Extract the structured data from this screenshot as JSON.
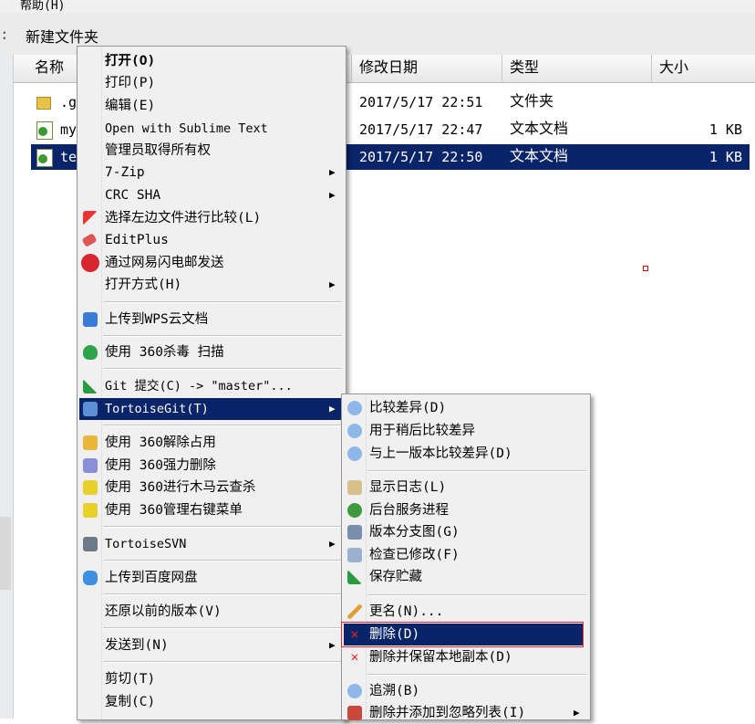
{
  "menubar": {
    "help": "帮助(H)"
  },
  "toolbar": {
    "sep": ":",
    "new_folder": "新建文件夹"
  },
  "columns": {
    "name": "名称",
    "modified": "修改日期",
    "type": "类型",
    "size": "大小"
  },
  "files": [
    {
      "name": ".g",
      "modified": "2017/5/17 22:51",
      "type": "文件夹",
      "size": "",
      "icon": "folder-icon"
    },
    {
      "name": "my",
      "modified": "2017/5/17 22:47",
      "type": "文本文档",
      "size": "1 KB",
      "icon": "text-file-icon"
    },
    {
      "name": "te",
      "modified": "2017/5/17 22:50",
      "type": "文本文档",
      "size": "1 KB",
      "icon": "text-file-icon",
      "selected": true
    }
  ],
  "context_menu": {
    "items": [
      {
        "label": "打开(O)",
        "bold": true
      },
      {
        "label": "打印(P)"
      },
      {
        "label": "编辑(E)"
      },
      {
        "label": "Open with Sublime Text"
      },
      {
        "label": "管理员取得所有权"
      },
      {
        "label": "7-Zip",
        "submenu": true
      },
      {
        "label": "CRC SHA",
        "submenu": true
      },
      {
        "label": "选择左边文件进行比较(L)",
        "icon": "compare-arrow-icon"
      },
      {
        "label": "EditPlus",
        "icon": "editplus-icon"
      },
      {
        "label": "通过网易闪电邮发送",
        "icon": "netease-mail-icon"
      },
      {
        "label": "打开方式(H)",
        "submenu": true
      },
      {
        "label": "上传到WPS云文档",
        "icon": "wps-cloud-icon"
      },
      {
        "label": "使用 360杀毒 扫描",
        "icon": "360-antivirus-icon"
      },
      {
        "label": "Git 提交(C) -> \"master\"...",
        "icon": "git-commit-icon"
      },
      {
        "label": "TortoiseGit(T)",
        "icon": "tortoisegit-icon",
        "submenu": true,
        "highlighted": true
      },
      {
        "label": "使用 360解除占用",
        "icon": "360-unlock-icon"
      },
      {
        "label": "使用 360强力删除",
        "icon": "360-shred-icon"
      },
      {
        "label": "使用 360进行木马云查杀",
        "icon": "360-trojan-icon"
      },
      {
        "label": "使用 360管理右键菜单",
        "icon": "360-menu-icon"
      },
      {
        "label": "TortoiseSVN",
        "icon": "tortoisesvn-icon",
        "submenu": true
      },
      {
        "label": "上传到百度网盘",
        "icon": "baidu-netdisk-icon"
      },
      {
        "label": "还原以前的版本(V)"
      },
      {
        "label": "发送到(N)",
        "submenu": true
      },
      {
        "label": "剪切(T)"
      },
      {
        "label": "复制(C)"
      }
    ]
  },
  "submenu": {
    "items": [
      {
        "label": "比较差异(D)",
        "icon": "diff-icon"
      },
      {
        "label": "用于稍后比较差异",
        "icon": "diff-later-icon"
      },
      {
        "label": "与上一版本比较差异(D)",
        "icon": "diff-prev-icon"
      },
      {
        "label": "显示日志(L)",
        "icon": "log-icon"
      },
      {
        "label": "后台服务进程",
        "icon": "daemon-icon"
      },
      {
        "label": "版本分支图(G)",
        "icon": "revision-graph-icon"
      },
      {
        "label": "检查已修改(F)",
        "icon": "check-modified-icon"
      },
      {
        "label": "保存贮藏",
        "icon": "stash-icon"
      },
      {
        "label": "更名(N)...",
        "icon": "rename-icon"
      },
      {
        "label": "删除(D)",
        "icon": "delete-icon",
        "highlighted": true
      },
      {
        "label": "删除并保留本地副本(D)",
        "icon": "delete-keep-icon"
      },
      {
        "label": "追溯(B)",
        "icon": "blame-icon"
      },
      {
        "label": "删除并添加到忽略列表(I)",
        "icon": "ignore-icon",
        "submenu": true
      }
    ]
  },
  "colors": {
    "selection": "#0a246a",
    "menu_bg": "#f0f0f0",
    "highlight_box": "#e22222"
  }
}
